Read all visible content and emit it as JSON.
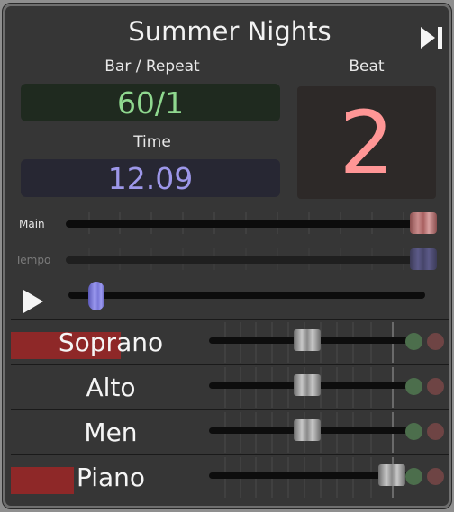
{
  "header": {
    "title": "Summer Nights",
    "skip_icon": "skip-forward-icon"
  },
  "readouts": {
    "bar_label": "Bar / Repeat",
    "bar_value": "60/1",
    "time_label": "Time",
    "time_value": "12.09",
    "beat_label": "Beat",
    "beat_value": "2"
  },
  "colors": {
    "bar_value": "#8fd88f",
    "time_value": "#9d97e9",
    "beat_value": "#ff9696",
    "main_knob": "#b06a6a",
    "tempo_knob": "#4c4a6e",
    "position_knob": "#8a88e8",
    "part_level": "#8e2828",
    "solo_dot": "#4c6e4c",
    "mute_dot": "#6e4444"
  },
  "sliders": {
    "main": {
      "label": "Main",
      "level": 0.98
    },
    "tempo": {
      "label": "Tempo",
      "level": 0.98
    }
  },
  "transport": {
    "play_icon": "play-icon",
    "position": 0.08
  },
  "parts": [
    {
      "name": "Soprano",
      "level_meter": 0.55,
      "volume": 0.5
    },
    {
      "name": "Alto",
      "level_meter": 0.0,
      "volume": 0.5
    },
    {
      "name": "Men",
      "level_meter": 0.0,
      "volume": 0.5
    },
    {
      "name": "Piano",
      "level_meter": 0.3,
      "volume": 0.92
    }
  ]
}
